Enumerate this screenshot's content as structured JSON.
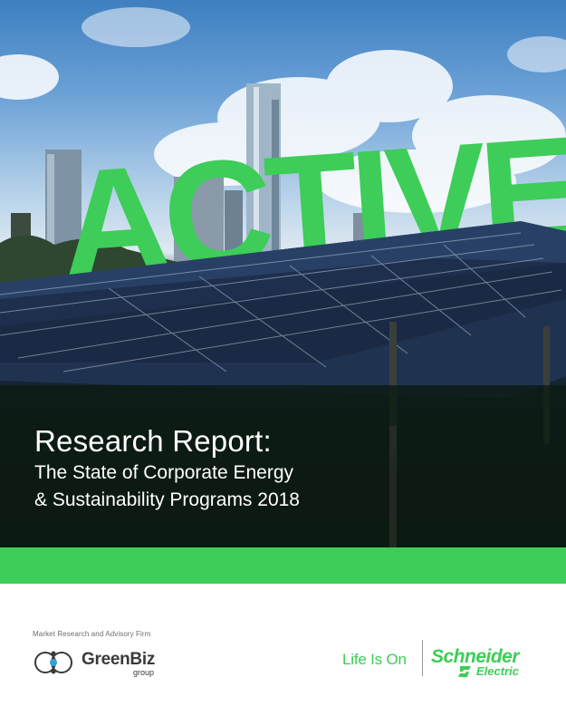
{
  "hero": {
    "headline": "ACTIVE",
    "title": "Research Report:",
    "subtitle_line1": "The State of Corporate Energy",
    "subtitle_line2": "& Sustainability Programs 2018"
  },
  "colors": {
    "accent_green": "#3dcd58",
    "text_white": "#ffffff",
    "text_grey": "#6d6e71"
  },
  "footer": {
    "firm_label": "Market Research and Advisory Firm",
    "greenbiz_name": "GreenBiz",
    "greenbiz_sub": "group",
    "tagline": "Life Is On",
    "schneider_name": "Schneider",
    "schneider_sub": "Electric"
  },
  "icons": [
    "greenbiz-logo-icon",
    "power-icon",
    "schneider-s-icon"
  ]
}
